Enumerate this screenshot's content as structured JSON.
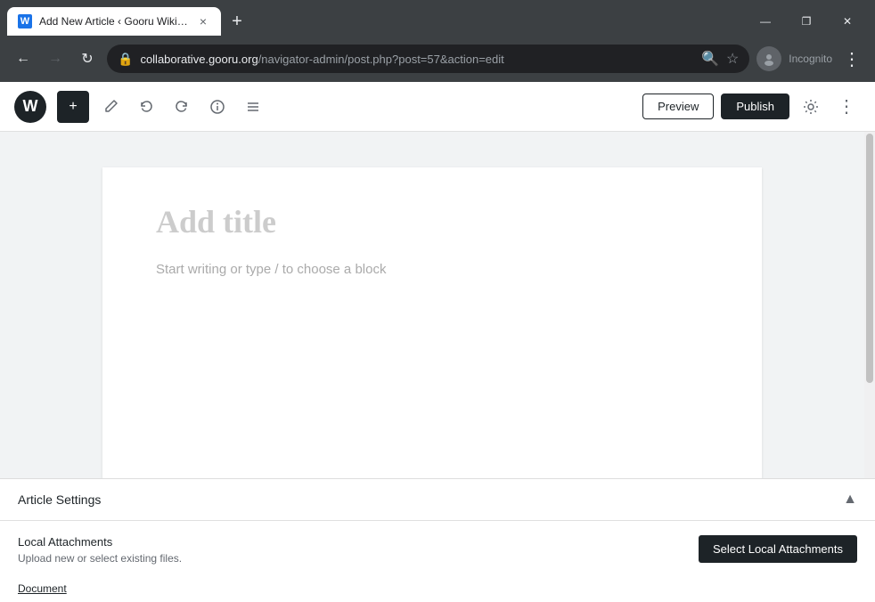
{
  "browser": {
    "tab_favicon": "W",
    "tab_title": "Add New Article ‹ Gooru Wiki —",
    "tab_close": "×",
    "new_tab": "+",
    "window_minimize": "—",
    "window_maximize": "❐",
    "window_close": "✕",
    "back_icon": "←",
    "forward_icon": "→",
    "refresh_icon": "↻",
    "url_domain": "collaborative.gooru.org",
    "url_path": "/navigator-admin/post.php?post=57&action=edit",
    "lock_icon": "🔒",
    "bookmark_icon": "☆",
    "search_icon": "🔍",
    "profile_label": "Incognito",
    "more_icon": "⋮"
  },
  "toolbar": {
    "wp_logo": "W",
    "add_icon": "+",
    "pen_icon": "✏",
    "undo_icon": "↩",
    "redo_icon": "↪",
    "info_icon": "ⓘ",
    "list_icon": "≡",
    "preview_label": "Preview",
    "publish_label": "Publish",
    "gear_icon": "⚙",
    "dots_icon": "⋮"
  },
  "editor": {
    "title_placeholder": "Add title",
    "block_placeholder": "Start writing or type / to choose a block"
  },
  "bottom_panel": {
    "settings_title": "Article Settings",
    "collapse_icon": "▲",
    "local_attachments_label": "Local Attachments",
    "local_attachments_desc": "Upload new or select existing files.",
    "select_btn_label": "Select Local Attachments",
    "document_link": "Document"
  }
}
